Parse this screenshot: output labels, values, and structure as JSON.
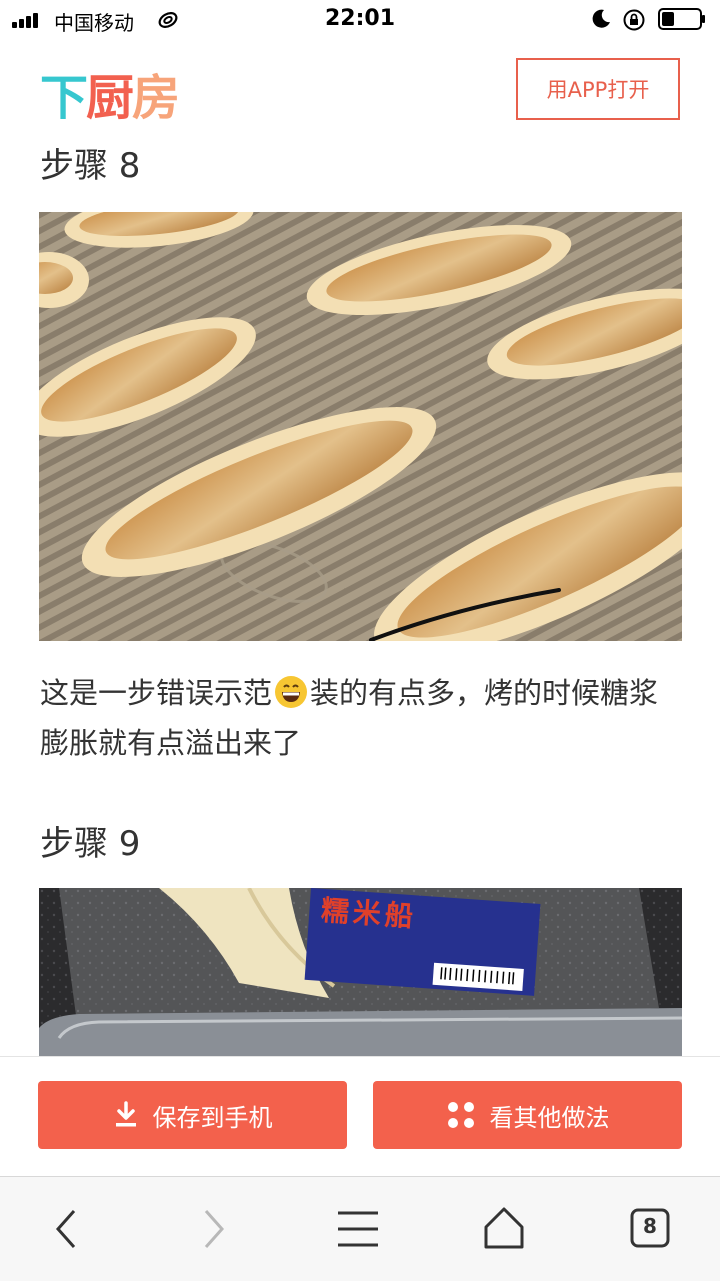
{
  "status_bar": {
    "carrier": "中国移动",
    "time": "22:01",
    "icons": [
      "signal-icon",
      "wifi-icon",
      "moon-icon",
      "orientation-lock-icon",
      "battery-icon"
    ]
  },
  "header": {
    "logo": {
      "part1": "下",
      "part2": "厨",
      "part3": "房"
    },
    "open_app_label": "用APP打开",
    "colors": {
      "logo_teal": "#36c7cf",
      "logo_red": "#f2604f",
      "logo_orange": "#f7a47a",
      "accent": "#e8604c"
    }
  },
  "steps": [
    {
      "title": "步骤 8",
      "description_before": "这是一步错误示范",
      "emoji": "grinning-face-emoji",
      "description_after": "装的有点多，烤的时候糖浆膨胀就有点溢出来了"
    },
    {
      "title": "步骤 9",
      "package_label": "糯米船"
    }
  ],
  "actions": {
    "save_label": "保存到手机",
    "other_label": "看其他做法",
    "button_color": "#f3614c"
  },
  "toolbar": {
    "tab_count": "8",
    "icons": [
      "back-icon",
      "forward-icon",
      "menu-icon",
      "home-icon",
      "tabs-icon"
    ]
  }
}
